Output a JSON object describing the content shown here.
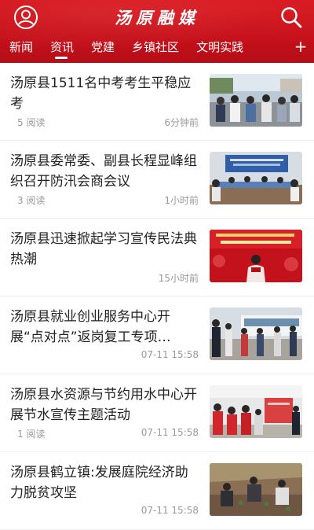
{
  "header": {
    "title": "汤原融媒",
    "user_icon": "user-icon",
    "search_icon": "search-icon",
    "brand_color": "#c8121b"
  },
  "tabs": [
    {
      "label": "新闻",
      "active": false
    },
    {
      "label": "资讯",
      "active": true
    },
    {
      "label": "党建",
      "active": false
    },
    {
      "label": "乡镇社区",
      "active": false
    },
    {
      "label": "文明实践",
      "active": false
    }
  ],
  "add_tab_label": "+",
  "feed": [
    {
      "title": "汤原县1511名中考考生平稳应考",
      "reads": "5 阅读",
      "time": "6分钟前",
      "thumb": "students-photo"
    },
    {
      "title": "汤原县委常委、副县长程显峰组织召开防汛会商会议",
      "reads": "3 阅读",
      "time": "1小时前",
      "thumb": "meeting-photo"
    },
    {
      "title": "汤原县迅速掀起学习宣传民法典热潮",
      "reads": "",
      "time": "15小时前",
      "thumb": "lecture-banner-photo"
    },
    {
      "title": "汤原县就业创业服务中心开展“点对点”返岗复工专项…",
      "reads": "",
      "time": "07-11 15:58",
      "thumb": "bus-crowd-photo"
    },
    {
      "title": "汤原县水资源与节约用水中心开展节水宣传主题活动",
      "reads": "1 阅读",
      "time": "07-11 15:58",
      "thumb": "volunteers-photo"
    },
    {
      "title": "汤原县鹤立镇:发展庭院经济助力脱贫攻坚",
      "reads": "",
      "time": "07-11 15:58",
      "thumb": "farming-photo"
    }
  ]
}
